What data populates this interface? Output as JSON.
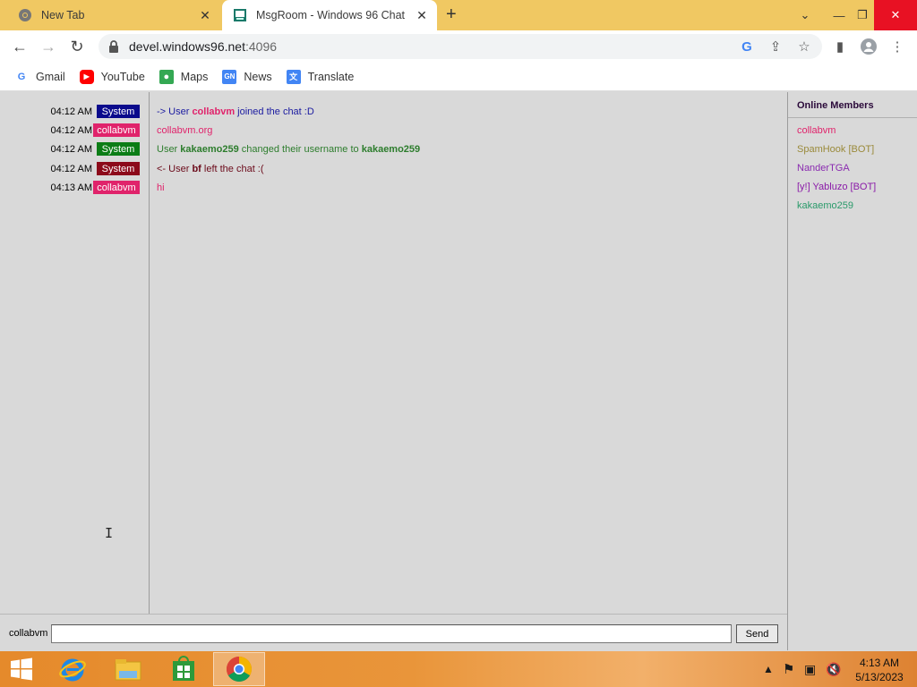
{
  "browser": {
    "tabs": [
      {
        "title": "New Tab",
        "active": false
      },
      {
        "title": "MsgRoom - Windows 96 Chat",
        "active": true
      }
    ],
    "address": {
      "host": "devel.windows96.net",
      "port": ":4096"
    },
    "bookmarks": [
      "Gmail",
      "YouTube",
      "Maps",
      "News",
      "Translate"
    ]
  },
  "chat": {
    "messages": [
      {
        "time": "04:12 AM",
        "user": "System",
        "badge_color": "#0a0a8c",
        "parts": [
          {
            "t": "-> User ",
            "b": false,
            "c": "#1a1aa0"
          },
          {
            "t": "collabvm",
            "b": true,
            "c": "#e0236b"
          },
          {
            "t": " joined the chat :D",
            "b": false,
            "c": "#1a1aa0"
          }
        ]
      },
      {
        "time": "04:12 AM",
        "user": "collabvm",
        "badge_color": "#e0236b",
        "parts": [
          {
            "t": "collabvm.org",
            "b": false,
            "c": "#e0236b"
          }
        ]
      },
      {
        "time": "04:12 AM",
        "user": "System",
        "badge_color": "#0b7d16",
        "parts": [
          {
            "t": "User ",
            "b": false,
            "c": "#2d7d2d"
          },
          {
            "t": "kakaemo259",
            "b": true,
            "c": "#2d7d2d"
          },
          {
            "t": " changed their username to ",
            "b": false,
            "c": "#2d7d2d"
          },
          {
            "t": "kakaemo259",
            "b": true,
            "c": "#2d7d2d"
          }
        ]
      },
      {
        "time": "04:12 AM",
        "user": "System",
        "badge_color": "#8c0a1a",
        "parts": [
          {
            "t": "<- User ",
            "b": false,
            "c": "#6b0a1a"
          },
          {
            "t": "bf",
            "b": true,
            "c": "#6b0a1a"
          },
          {
            "t": " left the chat :(",
            "b": false,
            "c": "#6b0a1a"
          }
        ]
      },
      {
        "time": "04:13 AM",
        "user": "collabvm",
        "badge_color": "#e0236b",
        "parts": [
          {
            "t": "hi",
            "b": false,
            "c": "#e0236b"
          }
        ]
      }
    ],
    "input": {
      "username": "collabvm",
      "value": "",
      "send_label": "Send"
    }
  },
  "members": {
    "title": "Online Members",
    "list": [
      {
        "name": "collabvm",
        "color": "#e0236b"
      },
      {
        "name": "SpamHook [BOT]",
        "color": "#9a8a3a"
      },
      {
        "name": "NanderTGA",
        "color": "#8a2bb0"
      },
      {
        "name": "[y!] Yabluzo [BOT]",
        "color": "#8a1aa8"
      },
      {
        "name": "kakaemo259",
        "color": "#2a9a6a"
      }
    ]
  },
  "taskbar": {
    "clock_time": "4:13 AM",
    "clock_date": "5/13/2023"
  }
}
